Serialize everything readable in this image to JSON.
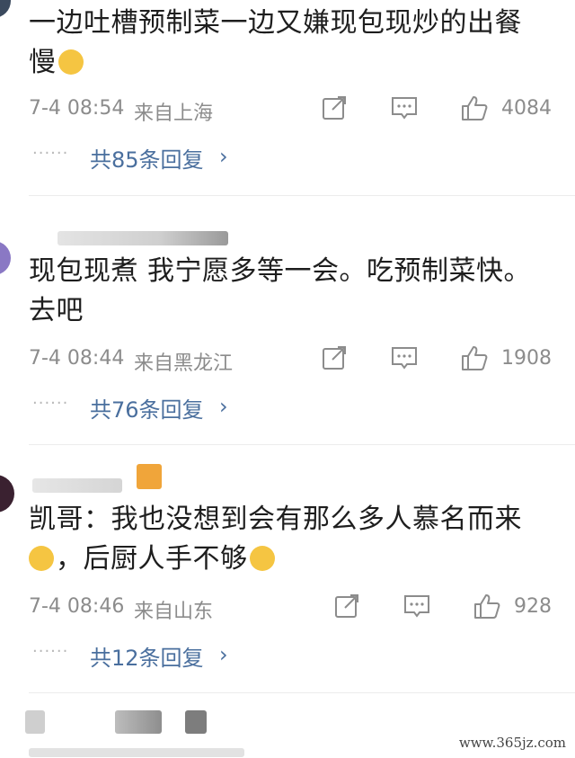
{
  "comments": [
    {
      "text_line1": "一边吐槽预制菜一边又嫌现包现炒的出餐",
      "text_line2": "慢",
      "time": "7-4 08:54",
      "location": "来自上海",
      "likes": "4084",
      "replies": "共85条回复"
    },
    {
      "text_line1": "现包现煮 我宁愿多等一会。吃预制菜快。",
      "text_line2": "去吧",
      "time": "7-4 08:44",
      "location": "来自黑龙江",
      "likes": "1908",
      "replies": "共76条回复"
    },
    {
      "text_line1": "凯哥：我也没想到会有那么多人慕名而来",
      "text_line2": "，后厨人手不够",
      "time": "7-4 08:46",
      "location": "来自山东",
      "likes": "928",
      "replies": "共12条回复"
    }
  ],
  "icons": {
    "share": "share-icon",
    "comment": "comment-icon",
    "like": "thumbs-up-icon",
    "more": "chevron-right-icon"
  },
  "colors": {
    "link": "#4a6f9e",
    "meta": "#8c8c8c",
    "text": "#1e1e1e",
    "divider": "#ececec"
  },
  "watermark": "www.365jz.com"
}
